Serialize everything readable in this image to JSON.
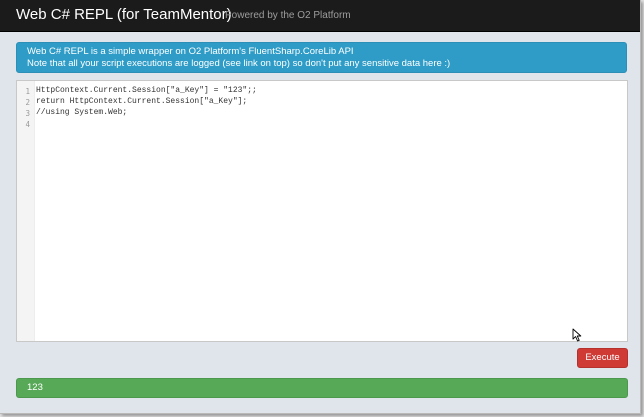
{
  "header": {
    "title": "Web C# REPL (for TeamMentor)",
    "tagline": "Powered by the O2 Platform"
  },
  "info": {
    "line1": "Web C# REPL is a simple wrapper on O2 Platform's FluentSharp.CoreLib API",
    "line2": "Note that all your script executions are logged (see link on top) so don't put any sensitive data here :)"
  },
  "editor": {
    "lines": [
      {
        "number": "1",
        "code": "HttpContext.Current.Session[\"a_Key\"] = \"123\";;"
      },
      {
        "number": "2",
        "code": "return HttpContext.Current.Session[\"a_Key\"];"
      },
      {
        "number": "3",
        "code": "//using System.Web;"
      },
      {
        "number": "4",
        "code": ""
      }
    ]
  },
  "actions": {
    "execute_label": "Execute"
  },
  "result": {
    "value": "123"
  },
  "colors": {
    "navbar": "#1b1b1b",
    "info": "#2e9cc7",
    "execute": "#cf3a35",
    "result": "#58a957"
  },
  "icons": {
    "cursor": "mouse-pointer-icon"
  }
}
